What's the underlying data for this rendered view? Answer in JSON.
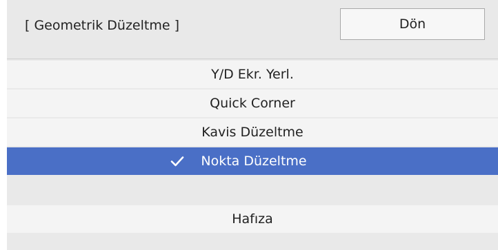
{
  "window": {
    "title": "[ Geometrik Düzeltme ]",
    "back_label": "Dön"
  },
  "menu": {
    "items": [
      {
        "label": "Y/D Ekr. Yerl.",
        "selected": false
      },
      {
        "label": "Quick Corner",
        "selected": false
      },
      {
        "label": "Kavis Düzeltme",
        "selected": false
      },
      {
        "label": "Nokta Düzeltme",
        "selected": true
      }
    ],
    "memory_label": "Hafıza"
  },
  "colors": {
    "panel_background": "#e9e9e9",
    "item_background": "#f4f4f4",
    "selected_background": "#4a6fc6",
    "selected_text": "#ffffff"
  },
  "icons": {
    "selected_marker": "checkmark-icon"
  }
}
